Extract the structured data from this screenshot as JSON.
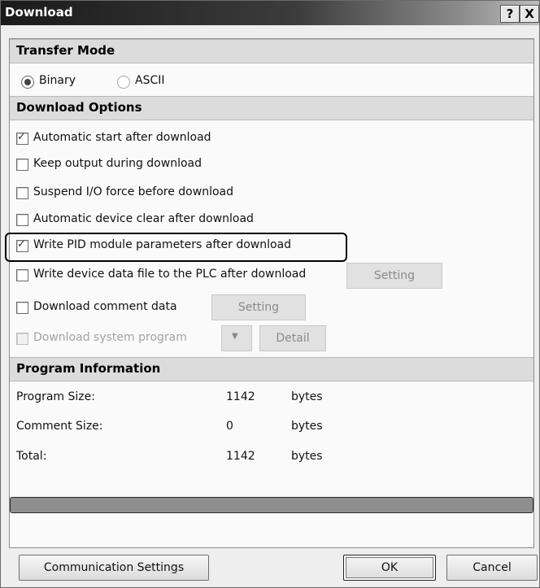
{
  "window": {
    "title": "Download",
    "help_label": "?",
    "close_label": "X"
  },
  "transfer_mode": {
    "header": "Transfer Mode",
    "options": [
      {
        "label": "Binary",
        "selected": true
      },
      {
        "label": "ASCII",
        "selected": false
      }
    ]
  },
  "download_options": {
    "header": "Download Options",
    "items": [
      {
        "label": "Automatic start after download",
        "checked": true,
        "enabled": true
      },
      {
        "label": "Keep output during download",
        "checked": false,
        "enabled": true
      },
      {
        "label": "Suspend I/O force before download",
        "checked": false,
        "enabled": true
      },
      {
        "label": "Automatic device clear after download",
        "checked": false,
        "enabled": true
      },
      {
        "label": "Write PID module parameters after download",
        "checked": true,
        "enabled": true
      },
      {
        "label": "Write device data file to the PLC after download",
        "checked": false,
        "enabled": true,
        "button": "Setting"
      },
      {
        "label": "Download comment data",
        "checked": false,
        "enabled": true,
        "button": "Setting"
      },
      {
        "label": "Download system program",
        "checked": false,
        "enabled": false,
        "button": "Detail"
      }
    ]
  },
  "program_information": {
    "header": "Program Information",
    "rows": [
      {
        "label": "Program Size:",
        "value": "1142",
        "unit": "bytes"
      },
      {
        "label": "Comment Size:",
        "value": "0",
        "unit": "bytes"
      },
      {
        "label": "Total:",
        "value": "1142",
        "unit": "bytes"
      }
    ]
  },
  "progress": 0,
  "buttons": {
    "communication": "Communication Settings",
    "ok": "OK",
    "cancel": "Cancel"
  },
  "colors": {
    "titlebar": "#1a1a1a",
    "section_bg": "#dcdcdc",
    "progress_fill": "#8e8e8e"
  }
}
